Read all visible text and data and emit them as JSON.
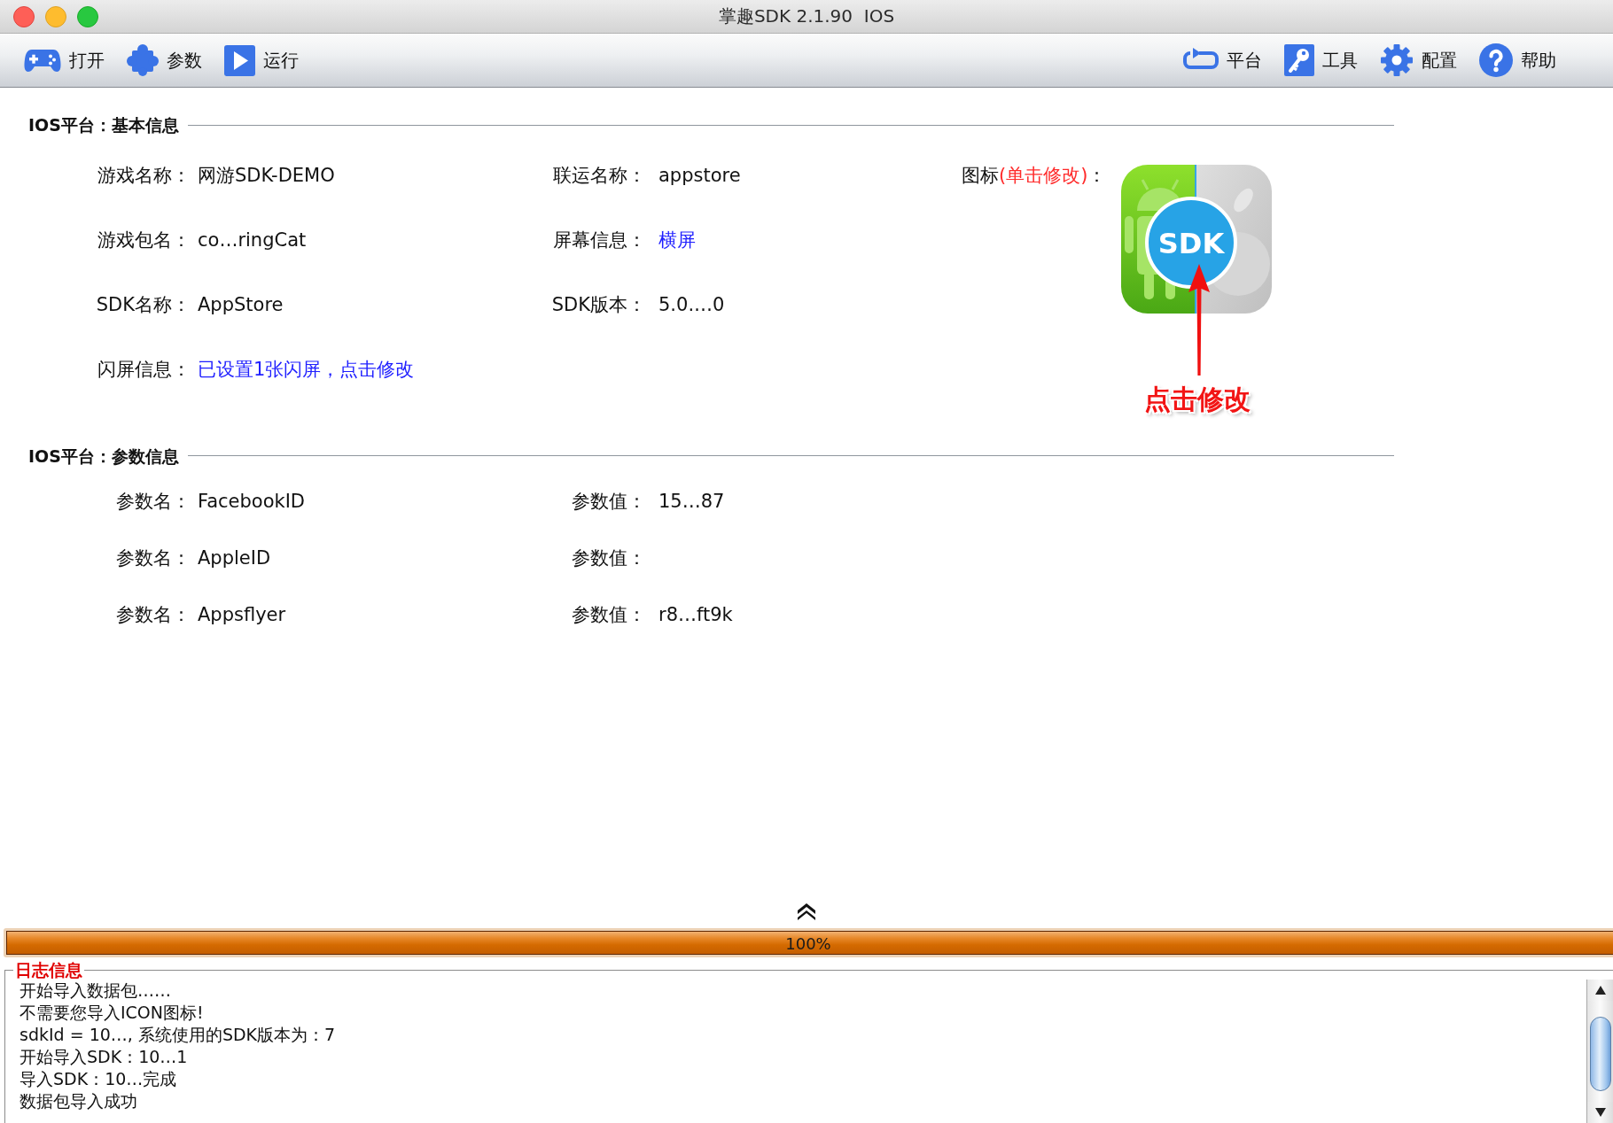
{
  "window": {
    "title": "掌趣SDK 2.1.90  IOS"
  },
  "toolbar": {
    "left": [
      {
        "label": "打开"
      },
      {
        "label": "参数"
      },
      {
        "label": "运行"
      }
    ],
    "right": [
      {
        "label": "平台"
      },
      {
        "label": "工具"
      },
      {
        "label": "配置"
      },
      {
        "label": "帮助"
      }
    ]
  },
  "basic_info": {
    "title": "IOS平台：基本信息",
    "fields": [
      {
        "label": "游戏名称：",
        "value": "网游SDK-DEMO",
        "kind": "text"
      },
      {
        "label": "联运名称：",
        "value": "appstore",
        "kind": "text"
      },
      {
        "label": "游戏包名：",
        "value": "co…ringCat",
        "kind": "text"
      },
      {
        "label": "屏幕信息：",
        "value": "横屏",
        "kind": "link"
      },
      {
        "label": "SDK名称：",
        "value": "AppStore",
        "kind": "text"
      },
      {
        "label": "SDK版本：",
        "value": "5.0.…0",
        "kind": "text"
      },
      {
        "label": "闪屏信息：",
        "value": "已设置1张闪屏，点击修改",
        "kind": "link"
      }
    ],
    "icon": {
      "label": "图标",
      "hint": "(单击修改)",
      "suffix": "：",
      "badge": "SDK"
    },
    "annotation": {
      "label": "点击修改"
    }
  },
  "params": {
    "title": "IOS平台：参数信息",
    "rows": [
      {
        "name_label": "参数名：",
        "name": "FacebookID",
        "value_label": "参数值：",
        "value": "15…87"
      },
      {
        "name_label": "参数名：",
        "name": "AppleID",
        "value_label": "参数值："
      },
      {
        "name_label": "参数名：",
        "name": "Appsflyer",
        "value_label": "参数值：",
        "value": "r8…ft9k"
      }
    ]
  },
  "progress": {
    "level": 1,
    "reading": "100%"
  },
  "log": {
    "title": "日志信息",
    "lines": [
      "开始导入数据包……",
      "不需要您导入ICON图标!",
      "sdkId = 10…, 系统使用的SDK版本为：7",
      "开始导入SDK：10…1",
      "导入SDK：10…完成",
      "数据包导入成功"
    ]
  }
}
